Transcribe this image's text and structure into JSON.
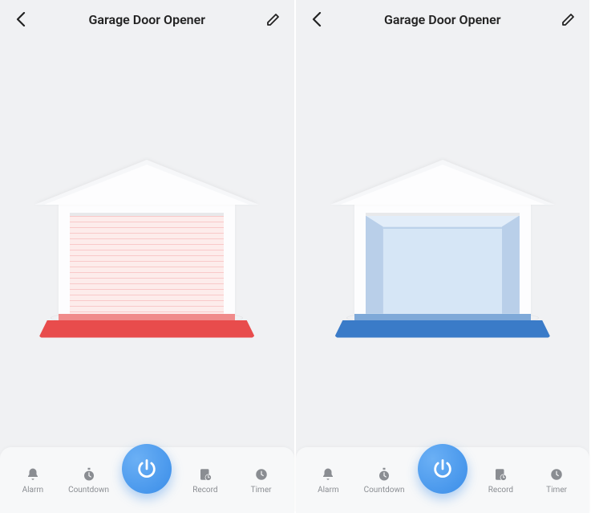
{
  "screens": [
    {
      "title": "Garage Door Opener",
      "door_state": "closed",
      "accent_color": "#e84c4c",
      "nav": {
        "alarm": "Alarm",
        "countdown": "Countdown",
        "record": "Record",
        "timer": "Timer"
      }
    },
    {
      "title": "Garage Door Opener",
      "door_state": "open",
      "accent_color": "#3a7bc8",
      "nav": {
        "alarm": "Alarm",
        "countdown": "Countdown",
        "record": "Record",
        "timer": "Timer"
      }
    }
  ]
}
